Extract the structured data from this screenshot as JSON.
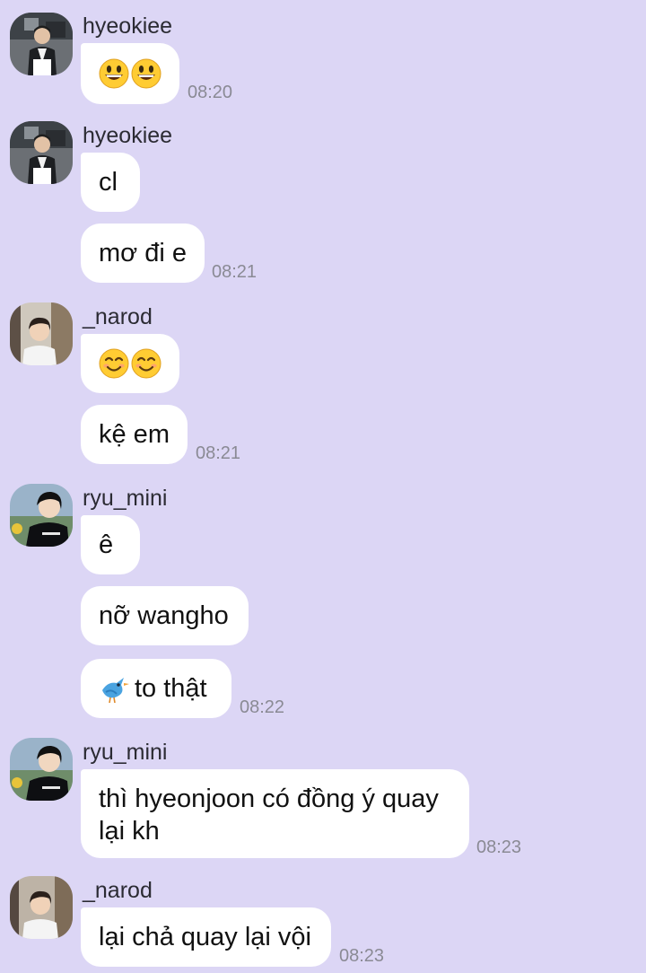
{
  "groups": [
    {
      "sender": "hyeokiee",
      "avatar_icon": "avatar-hyeokiee",
      "messages": [
        {
          "text": "",
          "emoji": [
            "grinning-face-icon",
            "grinning-face-icon"
          ]
        }
      ],
      "time": "08:20"
    },
    {
      "sender": "hyeokiee",
      "avatar_icon": "avatar-hyeokiee",
      "messages": [
        {
          "text": "cl"
        },
        {
          "text": "mơ đi e"
        }
      ],
      "time": "08:21"
    },
    {
      "sender": "_narod",
      "avatar_icon": "avatar-narod",
      "messages": [
        {
          "text": "",
          "emoji": [
            "smiling-face-icon",
            "smiling-face-icon"
          ]
        },
        {
          "text": "kệ em"
        }
      ],
      "time": "08:21"
    },
    {
      "sender": "ryu_mini",
      "avatar_icon": "avatar-ryu-mini",
      "messages": [
        {
          "text": "ê"
        },
        {
          "text": "nỡ wangho"
        },
        {
          "text": "to thật",
          "emoji": [
            "bird-icon"
          ]
        }
      ],
      "time": "08:22"
    },
    {
      "sender": "ryu_mini",
      "avatar_icon": "avatar-ryu-mini",
      "messages": [
        {
          "lines": [
            "thì hyeonjoon có đồng ý quay",
            "lại kh"
          ]
        }
      ],
      "time": "08:23"
    },
    {
      "sender": "_narod",
      "avatar_icon": "avatar-narod",
      "messages": [
        {
          "text": "lại chả quay lại vội"
        }
      ],
      "time": "08:23"
    }
  ],
  "colors": {
    "background": "#dcd6f5",
    "bubble": "#ffffff",
    "timestamp": "#8a8a94"
  }
}
